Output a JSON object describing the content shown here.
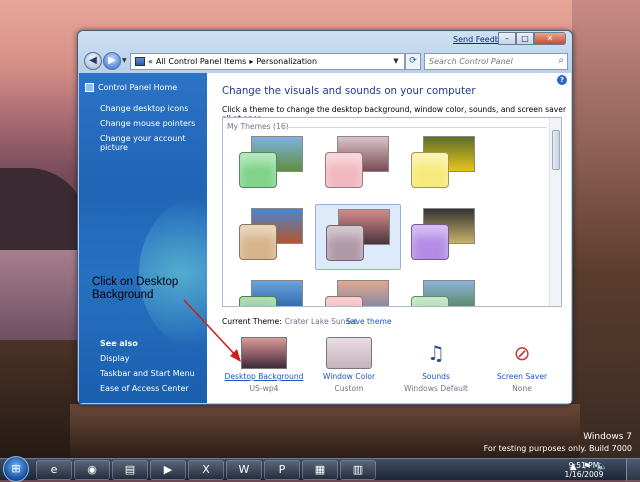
{
  "window": {
    "feedback": "Send Feedback",
    "controls": {
      "minimize": "–",
      "maximize": "□",
      "close": "✕"
    }
  },
  "address": {
    "chevron": "«",
    "segment1": "All Control Panel Items",
    "separator": "▸",
    "segment2": "Personalization",
    "search_placeholder": "Search Control Panel"
  },
  "sidebar": {
    "home": "Control Panel Home",
    "links": [
      "Change desktop icons",
      "Change mouse pointers",
      "Change your account picture"
    ],
    "see_also": "See also",
    "see_also_links": [
      "Display",
      "Taskbar and Start Menu",
      "Ease of Access Center"
    ]
  },
  "main": {
    "heading": "Change the visuals and sounds on your computer",
    "subheading": "Click a theme to change the desktop background, window color, sounds, and screen saver all at once.",
    "group_label": "My Themes (16)",
    "themes": [
      {
        "swatch": "#7fd38a",
        "img1": "#7fb0e0",
        "img2": "#5f8f3e",
        "selected": false
      },
      {
        "swatch": "#f0b8c0",
        "img1": "#d9c3c8",
        "img2": "#7a4c55",
        "selected": false
      },
      {
        "swatch": "#f7ea7a",
        "img1": "#5d6e28",
        "img2": "#e8c41a",
        "selected": false
      },
      {
        "swatch": "#d7b48c",
        "img1": "#4a86d0",
        "img2": "#b3562b",
        "selected": false
      },
      {
        "swatch": "#b09aa8",
        "img1": "#d48b87",
        "img2": "#4a3440",
        "selected": true
      },
      {
        "swatch": "#b48ce6",
        "img1": "#333333",
        "img2": "#c8b06a",
        "selected": false
      },
      {
        "swatch": "#78c07a",
        "img1": "#6ba3db",
        "img2": "#1f5b9e",
        "selected": false
      },
      {
        "swatch": "#f0a8b0",
        "img1": "#e0a890",
        "img2": "#6a7fa8",
        "selected": false
      },
      {
        "swatch": "#9ad6a0",
        "img1": "#8bb4d6",
        "img2": "#4e7a4e",
        "selected": false
      }
    ],
    "current_theme_label": "Current Theme:",
    "current_theme_name": "Crater Lake Sunset",
    "save_theme": "Save theme",
    "tiles": [
      {
        "label": "Desktop Background",
        "sub": "US-wp4"
      },
      {
        "label": "Window Color",
        "sub": "Custom"
      },
      {
        "label": "Sounds",
        "sub": "Windows Default"
      },
      {
        "label": "Screen Saver",
        "sub": "None"
      }
    ]
  },
  "annotation": "Click on Desktop Background",
  "watermark": {
    "line1": "Windows 7",
    "line2": "For testing purposes only. Build 7000"
  },
  "taskbar": {
    "start_glyph": "⊞",
    "items": [
      "e",
      "◉",
      "▤",
      "▶",
      "X",
      "W",
      "P",
      "▦",
      "▥"
    ],
    "tray": {
      "arrow": "▲",
      "flag": "⚑",
      "speaker": "🔈"
    },
    "time": "9:51 PM",
    "date": "1/16/2009"
  },
  "colors": {
    "link": "#1a56c4",
    "heading": "#1e3a8a",
    "sidebar": "#2c73c5",
    "arrow": "#cc1f1f"
  }
}
